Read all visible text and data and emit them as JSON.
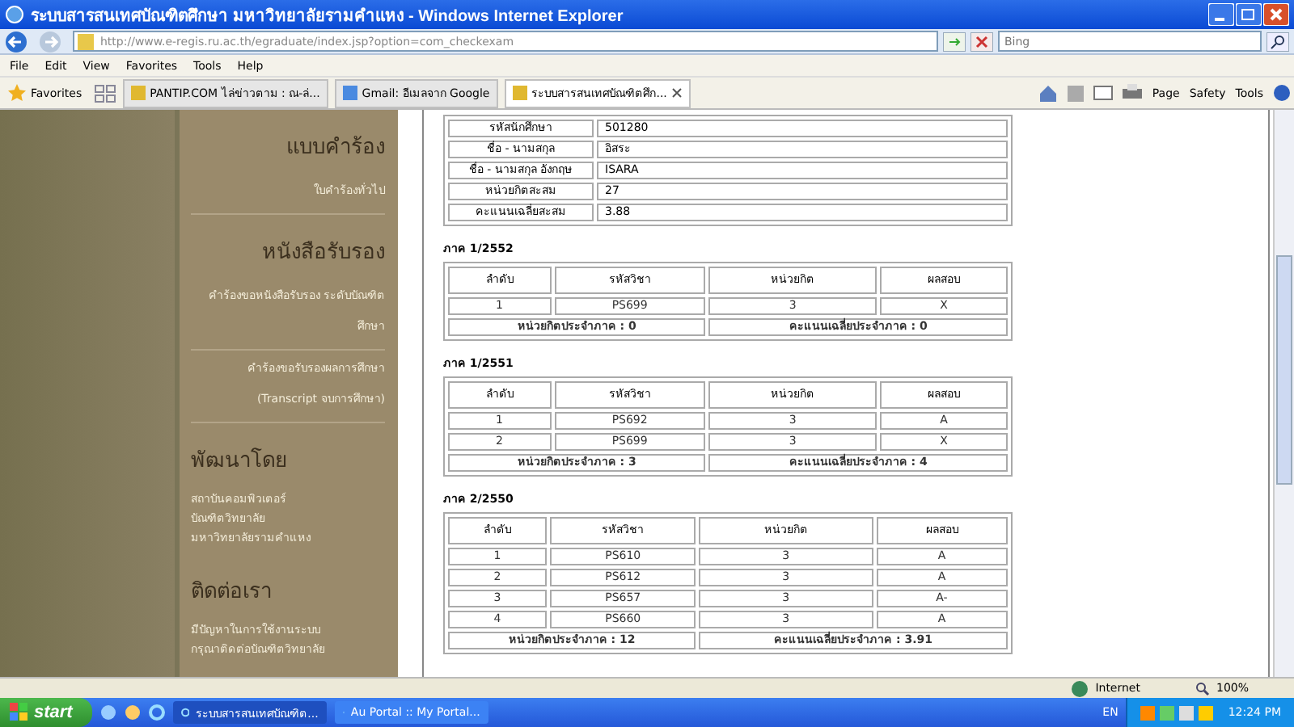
{
  "window": {
    "title": "ระบบสารสนเทศบัณฑิตศึกษา มหาวิทยาลัยรามคำแหง - Windows Internet Explorer"
  },
  "address_bar": {
    "url": "http://www.e-regis.ru.ac.th/egraduate/index.jsp?option=com_checkexam",
    "search_placeholder": "Bing"
  },
  "menu": [
    "File",
    "Edit",
    "View",
    "Favorites",
    "Tools",
    "Help"
  ],
  "favorites_label": "Favorites",
  "tabs": [
    {
      "label": "PANTIP.COM ไล่ข่าวตาม : ณ-ล่...",
      "selected": false
    },
    {
      "label": "Gmail: อีเมลจาก Google",
      "selected": false
    },
    {
      "label": "ระบบสารสนเทศบัณฑิตศึก...",
      "selected": true
    }
  ],
  "command_bar": [
    "Page",
    "Safety",
    "Tools"
  ],
  "sidebar": {
    "sections": [
      {
        "heading": "แบบคำร้อง",
        "links": [
          [
            "ใบคำร้องทั่วไป"
          ]
        ]
      },
      {
        "heading": "หนังสือรับรอง",
        "links": [
          [
            "คำร้องขอหนังสือรับรอง ระดับบัณฑิต",
            "ศึกษา"
          ],
          [
            "คำร้องขอรับรองผลการศึกษา",
            "(Transcript จบการศึกษา)"
          ]
        ]
      },
      {
        "heading": "พัฒนาโดย",
        "lines": [
          "สถาบันคอมพิวเตอร์",
          "บัณฑิตวิทยาลัย",
          "มหาวิทยาลัยรามคำแหง"
        ]
      },
      {
        "heading": "ติดต่อเรา",
        "lines": [
          "มีปัญหาในการใช้งานระบบ",
          "กรุณาติดต่อบัณฑิตวิทยาลัย"
        ]
      }
    ]
  },
  "student": [
    [
      "รหัสนักศึกษา",
      "501280"
    ],
    [
      "ชื่อ - นามสกุล",
      "อิสระ"
    ],
    [
      "ชื่อ - นามสกุล อังกฤษ",
      "ISARA"
    ],
    [
      "หน่วยกิตสะสม",
      "27"
    ],
    [
      "คะแนนเฉลี่ยสะสม",
      "3.88"
    ]
  ],
  "semesters": [
    {
      "title": "ภาค 1/2552",
      "columns": [
        "ลำดับ",
        "รหัสวิชา",
        "หน่วยกิต",
        "ผลสอบ"
      ],
      "rows": [
        [
          "1",
          "PS699",
          "3",
          "X"
        ]
      ],
      "credits": "หน่วยกิตประจำภาค : 0",
      "gpa": "คะแนนเฉลี่ยประจำภาค : 0"
    },
    {
      "title": "ภาค 1/2551",
      "columns": [
        "ลำดับ",
        "รหัสวิชา",
        "หน่วยกิต",
        "ผลสอบ"
      ],
      "rows": [
        [
          "1",
          "PS692",
          "3",
          "A"
        ],
        [
          "2",
          "PS699",
          "3",
          "X"
        ]
      ],
      "credits": "หน่วยกิตประจำภาค : 3",
      "gpa": "คะแนนเฉลี่ยประจำภาค : 4"
    },
    {
      "title": "ภาค 2/2550",
      "columns": [
        "ลำดับ",
        "รหัสวิชา",
        "หน่วยกิต",
        "ผลสอบ"
      ],
      "rows": [
        [
          "1",
          "PS610",
          "3",
          "A"
        ],
        [
          "2",
          "PS612",
          "3",
          "A"
        ],
        [
          "3",
          "PS657",
          "3",
          "A-"
        ],
        [
          "4",
          "PS660",
          "3",
          "A"
        ]
      ],
      "credits": "หน่วยกิตประจำภาค : 12",
      "gpa": "คะแนนเฉลี่ยประจำภาค : 3.91"
    }
  ],
  "status_bar": {
    "zone": "Internet",
    "zoom": "100%"
  },
  "taskbar": {
    "start": "start",
    "buttons": [
      {
        "label": "ระบบสารสนเทศบัณฑิต...",
        "selected": true
      },
      {
        "label": "Au Portal :: My Portal...",
        "selected": false
      }
    ],
    "language": "EN",
    "time": "12:24 PM"
  }
}
